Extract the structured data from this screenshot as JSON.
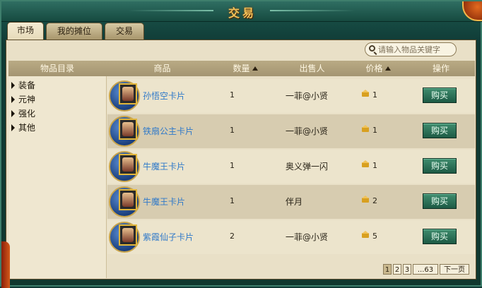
{
  "window": {
    "title": "交易"
  },
  "tabs": [
    {
      "label": "市场",
      "active": true
    },
    {
      "label": "我的摊位",
      "active": false
    },
    {
      "label": "交易",
      "active": false
    }
  ],
  "search": {
    "placeholder": "请输入物品关键字",
    "value": ""
  },
  "columns": {
    "catalog": "物品目录",
    "item": "商品",
    "quantity": "数量",
    "seller": "出售人",
    "price": "价格",
    "action": "操作"
  },
  "catalog": [
    {
      "label": "装备"
    },
    {
      "label": "元神"
    },
    {
      "label": "强化"
    },
    {
      "label": "其他"
    }
  ],
  "listings": [
    {
      "name": "孙悟空卡片",
      "quantity": "1",
      "seller": "一菲@小贤",
      "price": "1",
      "buy_label": "购买"
    },
    {
      "name": "铁扇公主卡片",
      "quantity": "1",
      "seller": "一菲@小贤",
      "price": "1",
      "buy_label": "购买"
    },
    {
      "name": "牛魔王卡片",
      "quantity": "1",
      "seller": "奥义弹一闪",
      "price": "1",
      "buy_label": "购买"
    },
    {
      "name": "牛魔王卡片",
      "quantity": "1",
      "seller": "伴月",
      "price": "2",
      "buy_label": "购买"
    },
    {
      "name": "紫霞仙子卡片",
      "quantity": "2",
      "seller": "一菲@小贤",
      "price": "5",
      "buy_label": "购买"
    }
  ],
  "pagination": {
    "pages": [
      "1",
      "2",
      "3"
    ],
    "current": "1",
    "last": "...63",
    "next_label": "下一页"
  },
  "colors": {
    "frame": "#0f3a35",
    "panel": "#e9e0c7",
    "title_gold": "#f1c35a",
    "link_blue": "#2f79c9",
    "buy_green": "#1d5a44"
  }
}
